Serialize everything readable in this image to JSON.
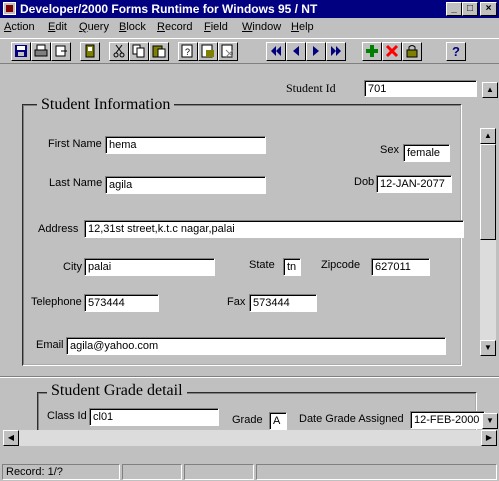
{
  "window": {
    "title": "Developer/2000 Forms Runtime for Windows 95 / NT"
  },
  "menu": [
    {
      "label": "Action",
      "u": "A",
      "rest": "ction"
    },
    {
      "label": "Edit",
      "u": "E",
      "rest": "dit"
    },
    {
      "label": "Query",
      "u": "Q",
      "rest": "uery"
    },
    {
      "label": "Block",
      "u": "B",
      "rest": "lock"
    },
    {
      "label": "Record",
      "u": "R",
      "rest": "ecord"
    },
    {
      "label": "Field",
      "u": "F",
      "rest": "ield"
    },
    {
      "label": "Window",
      "u": "W",
      "rest": "indow"
    },
    {
      "label": "Help",
      "u": "H",
      "rest": "elp"
    }
  ],
  "toolbar": {
    "icons": [
      "save-icon",
      "print-icon",
      "exit-icon",
      "print-preview-icon",
      "cut-icon",
      "copy-icon",
      "paste-icon",
      "query-icon",
      "execute-query-icon",
      "cancel-query-icon",
      "first-record-icon",
      "previous-record-icon",
      "next-record-icon",
      "last-record-icon",
      "insert-record-icon",
      "delete-record-icon",
      "lock-record-icon",
      "help-icon"
    ]
  },
  "form": {
    "student_id_label": "Student Id",
    "student_id_value": "701",
    "student_info_title": "Student Information",
    "first_name_label": "First Name",
    "first_name_value": "hema",
    "sex_label": "Sex",
    "sex_value": "female",
    "last_name_label": "Last Name",
    "last_name_value": "agila",
    "dob_label": "Dob",
    "dob_value": "12-JAN-2077",
    "address_label": "Address",
    "address_value": "12,31st street,k.t.c nagar,palai",
    "city_label": "City",
    "city_value": "palai",
    "state_label": "State",
    "state_value": "tn",
    "zipcode_label": "Zipcode",
    "zipcode_value": "627011",
    "telephone_label": "Telephone",
    "telephone_value": "573444",
    "fax_label": "Fax",
    "fax_value": "573444",
    "email_label": "Email",
    "email_value": "agila@yahoo.com",
    "grade_detail_title": "Student Grade detail",
    "class_id_label": "Class Id",
    "class_id_value": "cl01",
    "grade_label": "Grade",
    "grade_value": "A",
    "date_grade_label": "Date Grade Assigned",
    "date_grade_value": "12-FEB-2000"
  },
  "status": {
    "record": "Record: 1/?"
  },
  "colors": {
    "titlebar": "#000080",
    "face": "#c0c0c0"
  }
}
